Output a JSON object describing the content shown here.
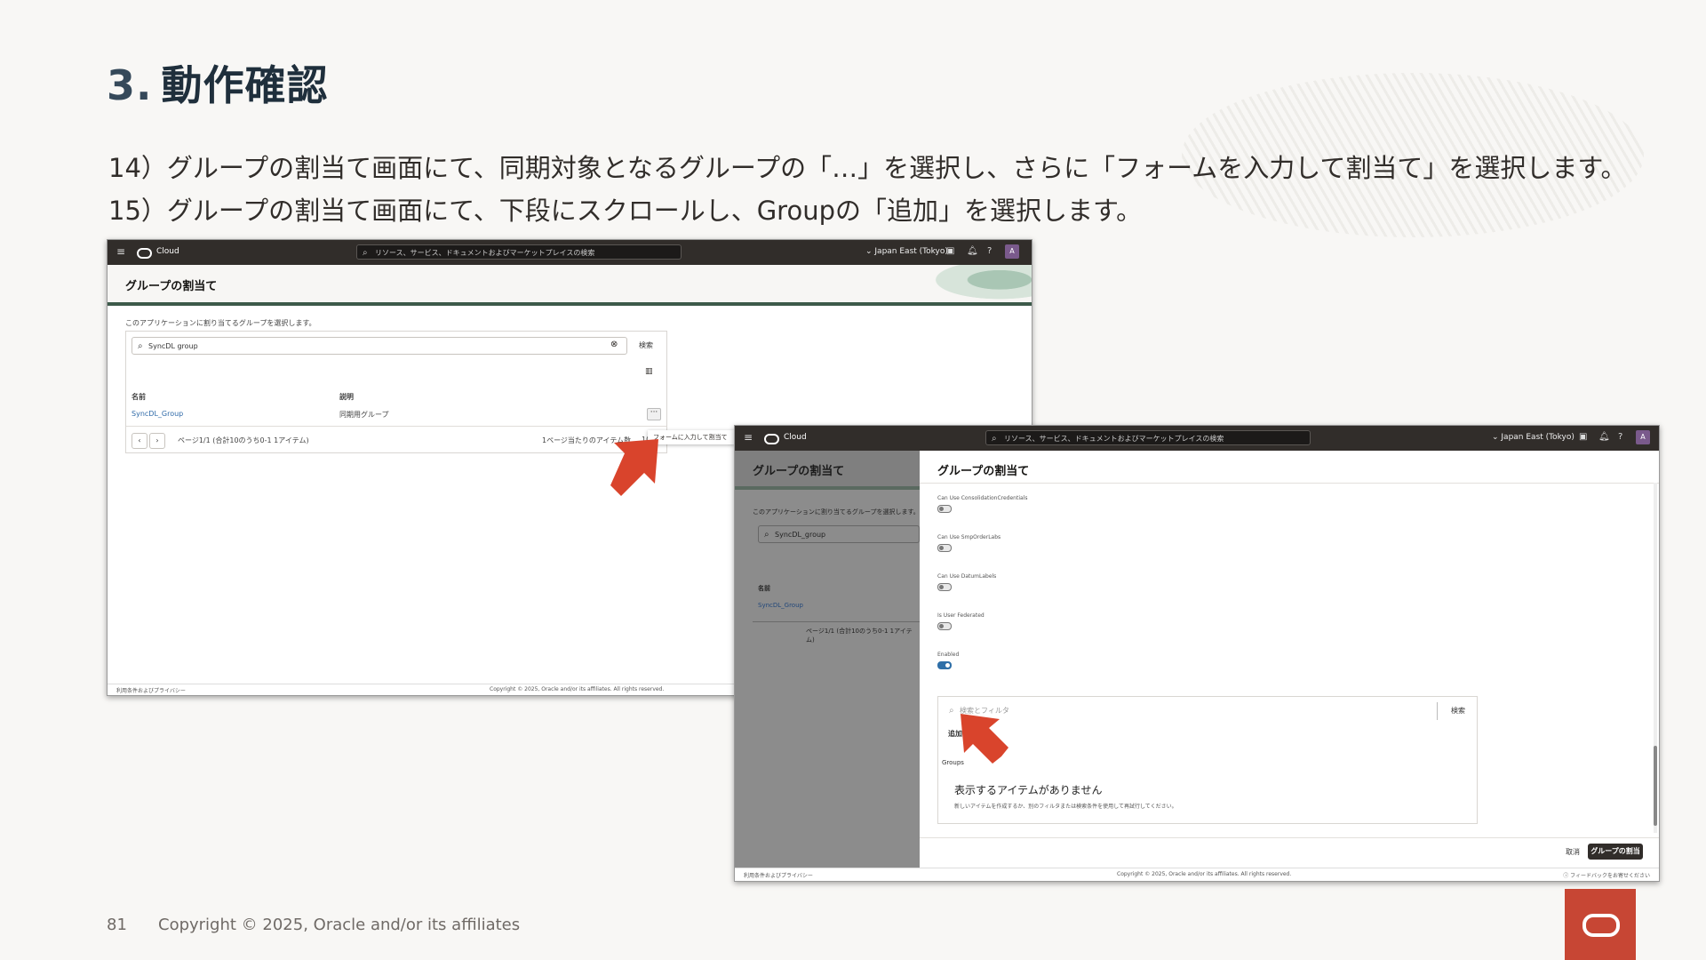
{
  "slide": {
    "number": "3.",
    "title": "動作確認",
    "step14": "14）グループの割当て画面にて、同期対象となるグループの「…」を選択し、さらに「フォームを入力して割当て」を選択します。",
    "step15": "15）グループの割当て画面にて、下段にスクロールし、Groupの「追加」を選択します。",
    "page_number": "81",
    "copyright": "Copyright © 2025, Oracle and/or its affiliates"
  },
  "screenshot1": {
    "brand": "Cloud",
    "search_placeholder": "リソース、サービス、ドキュメントおよびマーケットプレイスの検索",
    "region": "Japan East (Tokyo)",
    "avatar": "A",
    "page_title": "グループの割当て",
    "description": "このアプリケーションに割り当てるグループを選択します。",
    "search_value": "SyncDL group",
    "search_button": "検索",
    "col_name": "名前",
    "col_desc": "説明",
    "row_name": "SyncDL_Group",
    "row_desc": "同期用グループ",
    "pagination": "ページ1/1 (合計10のうち0-1 1アイテム)",
    "per_page_label": "1ページ当たりのアイテム数",
    "per_page_value": "10",
    "menu_item": "フォームに入力して割当て",
    "footer_left": "利用条件およびプライバシー",
    "footer_center": "Copyright © 2025, Oracle and/or its affiliates. All rights reserved."
  },
  "screenshot2": {
    "brand": "Cloud",
    "search_placeholder": "リソース、サービス、ドキュメントおよびマーケットプレイスの検索",
    "region": "Japan East (Tokyo)",
    "avatar": "A",
    "left_title": "グループの割当て",
    "left_desc": "このアプリケーションに割り当てるグループを選択します。",
    "left_search": "SyncDL_group",
    "left_col": "名前",
    "left_row": "SyncDL_Group",
    "left_pagination": "ページ1/1 (合計10のうち0-1 1アイテム)",
    "drawer_title": "グループの割当て",
    "toggles": [
      {
        "label": "Can Use ConsolidationCredentials",
        "on": false
      },
      {
        "label": "Can Use SmpOrderLabs",
        "on": false
      },
      {
        "label": "Can Use DatumLabels",
        "on": false
      },
      {
        "label": "Is User Federated",
        "on": false
      },
      {
        "label": "Enabled",
        "on": true
      }
    ],
    "filter_placeholder": "検索とフィルタ",
    "filter_button": "検索",
    "add_button": "追加",
    "groups_label": "Groups",
    "empty_title": "表示するアイテムがありません",
    "empty_desc": "新しいアイテムを作成するか、別のフィルタまたは検索条件を使用して再試行してください。",
    "cancel_button": "取消",
    "assign_button": "グループの割当て",
    "footer_left": "利用条件およびプライバシー",
    "footer_center": "Copyright © 2025, Oracle and/or its affiliates. All rights reserved.",
    "footer_right": "フィードバックをお寄せください"
  },
  "colors": {
    "title": "#1f2f3c",
    "oracle_red": "#c74634",
    "arrow": "#d9442c",
    "topbar": "#312d2a"
  }
}
